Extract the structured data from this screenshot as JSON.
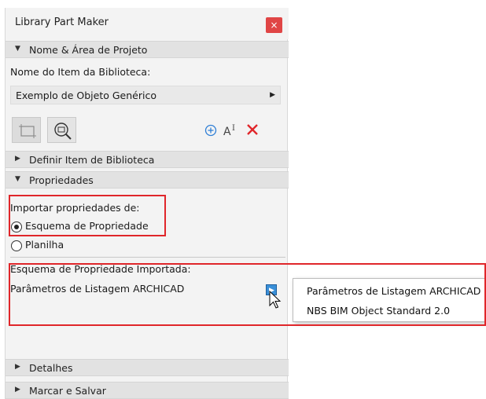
{
  "window": {
    "title": "Library Part Maker",
    "close_glyph": "×"
  },
  "sections": {
    "nome_area": "Nome & Área de Projeto",
    "definir": "Definir Item de Biblioteca",
    "propriedades": "Propriedades",
    "detalhes": "Detalhes",
    "marcar": "Marcar e Salvar"
  },
  "name_section": {
    "label": "Nome do Item da Biblioteca:",
    "selected_value": "Exemplo de Objeto Genérico"
  },
  "properties": {
    "import_label": "Importar propriedades de:",
    "option_schema": "Esquema de Propriedade",
    "option_sheet": "Planilha",
    "selected_option": "Esquema de Propriedade",
    "imported_label": "Esquema de Propriedade Importada:",
    "imported_value": "Parâmetros de Listagem ARCHICAD"
  },
  "popup_menu": {
    "options": [
      "Parâmetros de Listagem ARCHICAD",
      "NBS BIM Object Standard 2.0"
    ]
  },
  "colors": {
    "accent_blue": "#3a8fd8",
    "delete_red": "#e0262a",
    "highlight_box": "#e0262a"
  },
  "icons": [
    "rectangle-select-icon",
    "zoom-select-icon",
    "add-circle-icon",
    "text-tool-icon",
    "delete-x-icon",
    "mouse-cursor-icon"
  ]
}
